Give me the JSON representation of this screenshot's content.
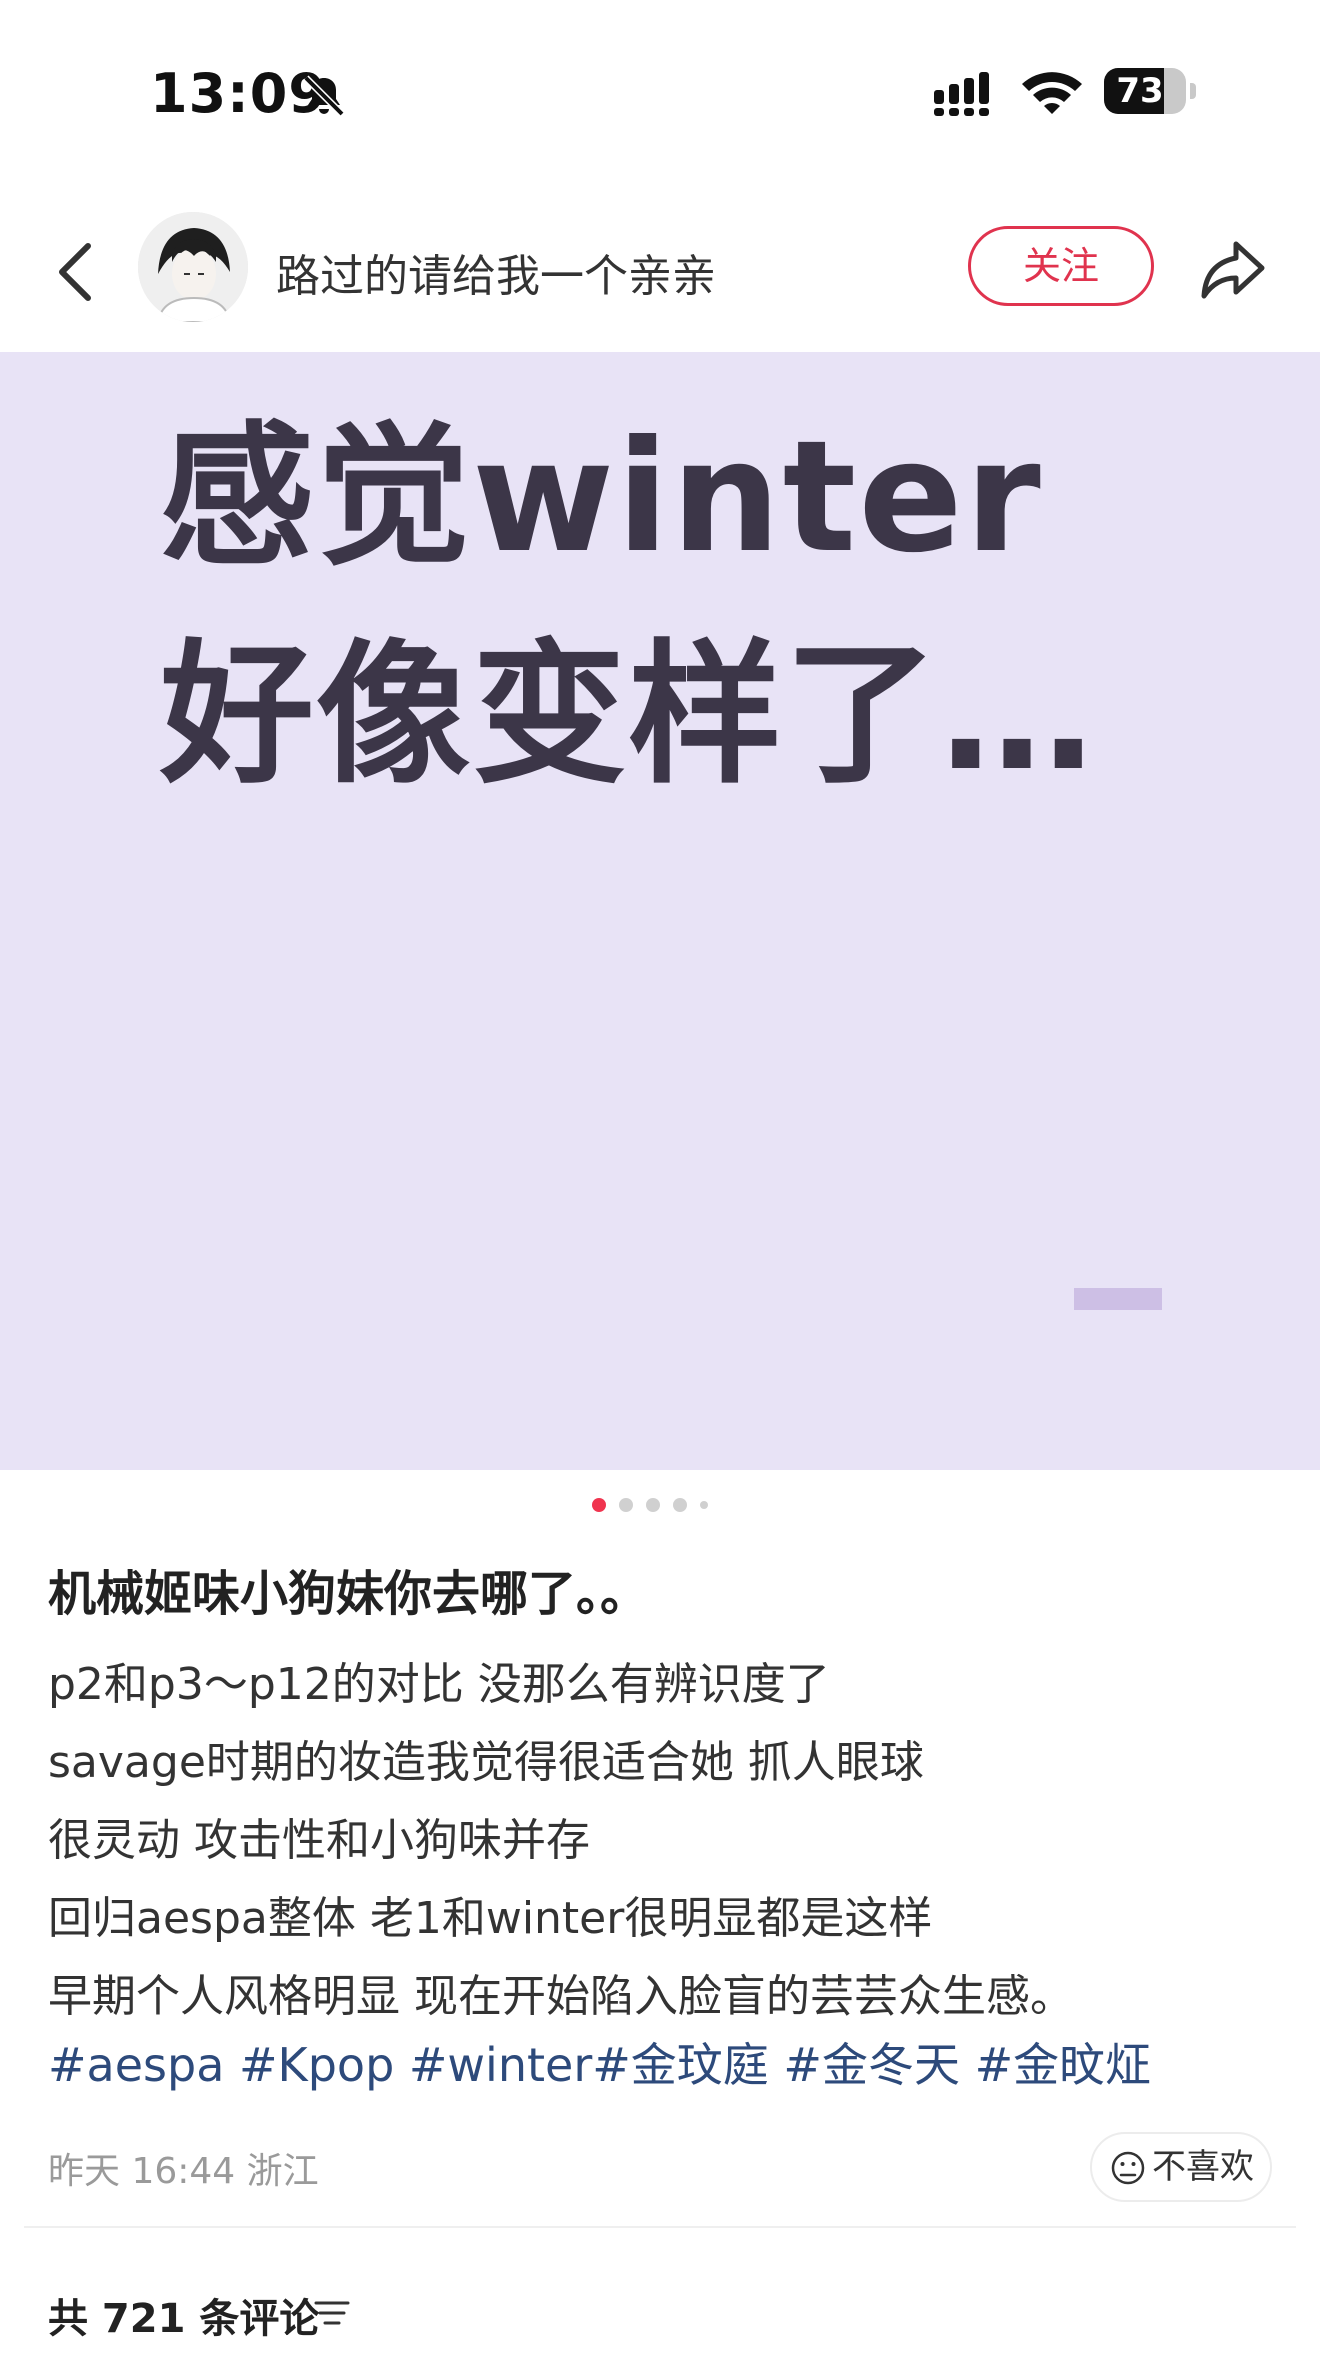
{
  "status_bar": {
    "time": "13:09",
    "battery_level": 73,
    "battery_label": "73"
  },
  "header": {
    "author_name": "路过的请给我一个亲亲",
    "follow_label": "关注"
  },
  "image": {
    "line1": "感觉winter",
    "line2": "好像变样了…",
    "background_color": "#e8e3f6",
    "text_color": "#3c3648"
  },
  "pagination": {
    "total": 5,
    "current": 1,
    "active_color": "#f0344f"
  },
  "post": {
    "title": "机械姬味小狗妹你去哪了。。",
    "body_lines": [
      "p2和p3～p12的对比 没那么有辨识度了",
      "savage时期的妆造我觉得很适合她 抓人眼球",
      "很灵动 攻击性和小狗味并存",
      "回归aespa整体 老1和winter很明显都是这样",
      "早期个人风格明显 现在开始陷入脸盲的芸芸众生感。"
    ],
    "tags": [
      "#aespa",
      "#Kpop",
      "#winter#金玟庭",
      "#金冬天",
      "#金旼炡"
    ],
    "tag_color": "#2d4a7b",
    "date": "昨天 16:44 浙江",
    "dislike_label": "不喜欢"
  },
  "comments": {
    "count_label": "共 721 条评论"
  },
  "icons": {
    "back": "chevron-left-icon",
    "mute": "bell-slash-icon",
    "share": "share-arrow-icon",
    "dislike": "frown-face-icon",
    "sort": "sort-lines-icon"
  }
}
